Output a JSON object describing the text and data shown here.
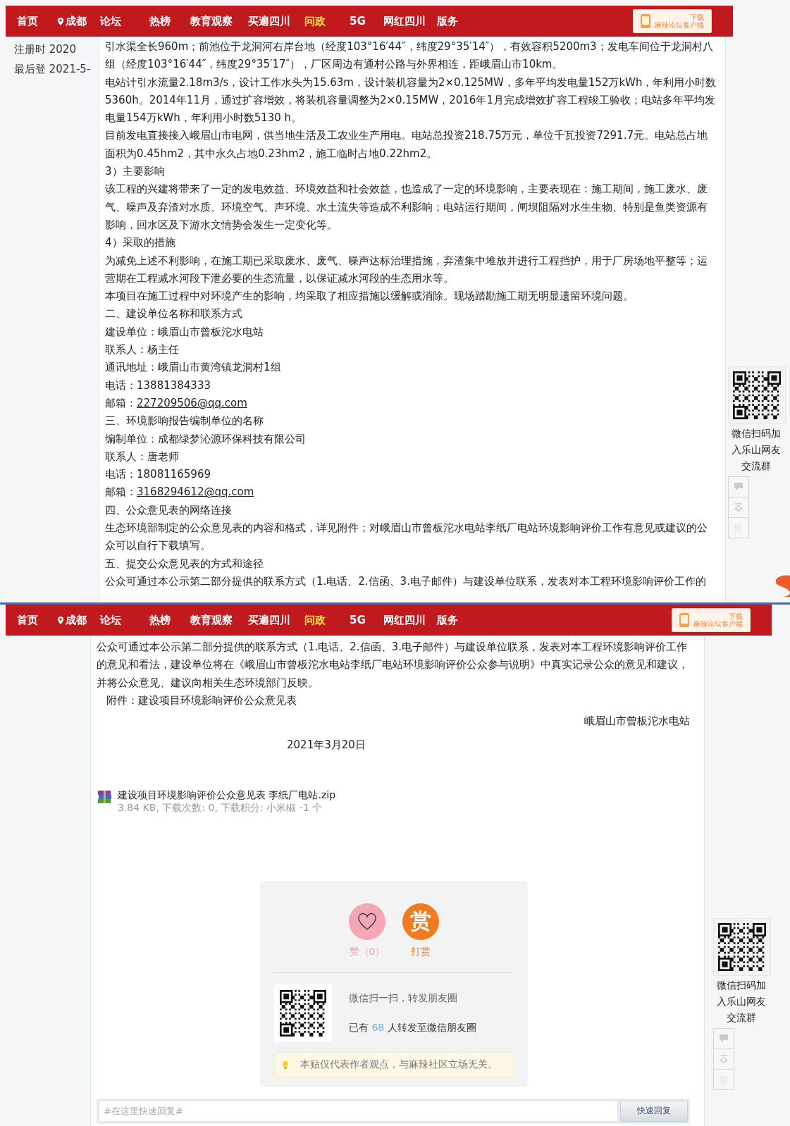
{
  "screens": [
    {
      "nav": {
        "items": [
          {
            "label": "首页",
            "kind": "link",
            "selected": false
          },
          {
            "label": "成都",
            "kind": "location",
            "selected": false
          },
          {
            "label": "论坛",
            "kind": "link",
            "selected": false
          },
          {
            "label": "热榜",
            "kind": "link",
            "selected": false
          },
          {
            "label": "教育观察",
            "kind": "link",
            "selected": false
          },
          {
            "label": "买遍四川",
            "kind": "link",
            "selected": false
          },
          {
            "label": "问政",
            "kind": "link",
            "selected": true
          },
          {
            "label": "5G",
            "kind": "link",
            "selected": false
          },
          {
            "label": "网红四川",
            "kind": "link",
            "selected": false
          },
          {
            "label": "版务",
            "kind": "link",
            "selected": false
          }
        ],
        "download": {
          "label": "下载",
          "caption": "麻辣论坛客户端"
        }
      },
      "user_info": [
        "注册时 2020",
        "最后登 2021-5-"
      ],
      "blocks": [
        {
          "kind": "text",
          "text": "引水渠全长960m；前池位于龙洞河右岸台地（经度103°16′44″，纬度29°35′14″），有效容积5200m3；发电车间位于龙洞村八组（经度103°16′44″，纬度29°35′17″），厂区周边有通村公路与外界相连，距峨眉山市10km。"
        },
        {
          "kind": "text",
          "text": "电站计引水流量2.18m3/s，设计工作水头为15.63m，设计装机容量为2×0.125MW，多年平均发电量152万kWh，年利用小时数5360h。2014年11月，通过扩容增效，将装机容量调整为2×0.15MW，2016年1月完成增效扩容工程竣工验收；电站多年平均发电量154万kWh，年利用小时数5130 h。"
        },
        {
          "kind": "text",
          "text": "目前发电直接接入峨眉山市电网，供当地生活及工农业生产用电。电站总投资218.75万元，单位千瓦投资7291.7元。电站总占地面积为0.45hm2，其中永久占地0.23hm2，施工临时占地0.22hm2。"
        },
        {
          "kind": "text",
          "text": "3）主要影响"
        },
        {
          "kind": "text",
          "text": "该工程的兴建将带来了一定的发电效益、环境效益和社会效益，也造成了一定的环境影响，主要表现在：施工期间，施工废水、废气、噪声及弃渣对水质、环境空气、声环境、水土流失等造成不利影响；电站运行期间，闸坝阻隔对水生生物、特别是鱼类资源有影响，回水区及下游水文情势会发生一定变化等。"
        },
        {
          "kind": "text",
          "text": "4）采取的措施"
        },
        {
          "kind": "text",
          "text": "为减免上述不利影响，在施工期已采取废水、废气、噪声达标治理措施，弃渣集中堆放并进行工程挡护，用于厂房场地平整等；运营期在工程减水河段下泄必要的生态流量，以保证减水河段的生态用水等。"
        },
        {
          "kind": "text",
          "text": "本项目在施工过程中对环境产生的影响，均采取了相应措施以缓解或消除。现场踏勘施工期无明显遗留环境问题。"
        },
        {
          "kind": "text",
          "text": "二、建设单位名称和联系方式"
        },
        {
          "kind": "text",
          "text": "建设单位：峨眉山市曾板沱水电站"
        },
        {
          "kind": "text",
          "text": "联系人：杨主任"
        },
        {
          "kind": "text",
          "text": "通讯地址：峨眉山市黄湾镇龙洞村1组"
        },
        {
          "kind": "text",
          "text": "电话：13881384333"
        },
        {
          "kind": "email",
          "label": "邮箱：",
          "link": "227209506@qq.com"
        },
        {
          "kind": "text",
          "text": "三、环境影响报告编制单位的名称"
        },
        {
          "kind": "text",
          "text": "编制单位：成都绿梦沁源环保科技有限公司"
        },
        {
          "kind": "text",
          "text": "联系人：唐老师"
        },
        {
          "kind": "text",
          "text": "电话：18081165969"
        },
        {
          "kind": "email",
          "label": "邮箱：",
          "link": "3168294612@qq.com"
        },
        {
          "kind": "text",
          "text": "四、公众意见表的网络连接"
        },
        {
          "kind": "text",
          "text": "生态环境部制定的公众意见表的内容和格式，详见附件；对峨眉山市曾板沱水电站李纸厂电站环境影响评价工作有意见或建议的公众可以自行下载填写。"
        },
        {
          "kind": "text",
          "text": "五、提交公众意见表的方式和途径"
        },
        {
          "kind": "text",
          "text": "公众可通过本公示第二部分提供的联系方式（1.电话、2.信函、3.电子邮件）与建设单位联系，发表对本工程环境影响评价工作的"
        }
      ],
      "side_widget": {
        "caption": "微信扫码加入乐山网友交流群"
      }
    },
    {
      "nav": {
        "items": [
          {
            "label": "首页",
            "kind": "link",
            "selected": false
          },
          {
            "label": "成都",
            "kind": "location",
            "selected": false
          },
          {
            "label": "论坛",
            "kind": "link",
            "selected": false
          },
          {
            "label": "热榜",
            "kind": "link",
            "selected": false
          },
          {
            "label": "教育观察",
            "kind": "link",
            "selected": false
          },
          {
            "label": "买遍四川",
            "kind": "link",
            "selected": false
          },
          {
            "label": "问政",
            "kind": "link",
            "selected": true
          },
          {
            "label": "5G",
            "kind": "link",
            "selected": false
          },
          {
            "label": "网红四川",
            "kind": "link",
            "selected": false
          },
          {
            "label": "版务",
            "kind": "link",
            "selected": false
          }
        ],
        "download": {
          "label": "下载",
          "caption": "麻辣论坛客户端"
        }
      },
      "blocks": [
        {
          "kind": "text",
          "text": "公众可通过本公示第二部分提供的联系方式（1.电话、2.信函、3.电子邮件）与建设单位联系，发表对本工程环境影响评价工作的意见和看法，建设单位将在《峨眉山市曾板沱水电站李纸厂电站环境影响评价公众参与说明》中真实记录公众的意见和建议，并将公众意见、建议向相关生态环境部门反映。"
        },
        {
          "kind": "indent",
          "text": "附件：建设项目环境影响评价公众意见表"
        },
        {
          "kind": "right",
          "text": "峨眉山市曾板沱水电站"
        },
        {
          "kind": "center",
          "text": "2021年3月20日"
        }
      ],
      "attachment": {
        "name": "建设项目环境影响评价公众意见表 李纸厂电站.zip",
        "info": "3.84 KB, 下载次数: 0, 下载积分: 小米椒 -1 个"
      },
      "share_card": {
        "like_label": "赞（0）",
        "reward_badge": "赏",
        "reward_label": "打赏",
        "share_title": "微信扫一扫，转发朋友圈",
        "share_prefix": "已有",
        "share_count": "68",
        "share_suffix": "人转发至微信朋友圈",
        "notice": "本贴仅代表作者观点，与麻辣社区立场无关。"
      },
      "quick_reply": {
        "placeholder": "#在这里快速回复#",
        "button": "快速回复"
      },
      "side_widget": {
        "caption": "微信扫码加入乐山网友交流群"
      }
    }
  ]
}
